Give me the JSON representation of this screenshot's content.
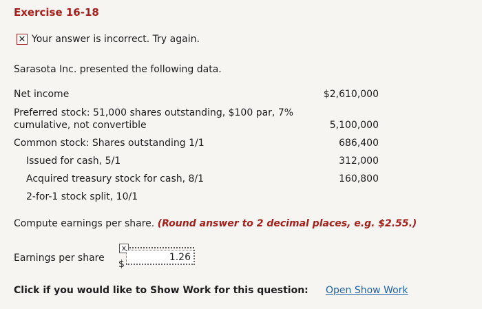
{
  "exercise_title": "Exercise 16-18",
  "status": {
    "icon": "x-icon",
    "message": "Your answer is incorrect.  Try again."
  },
  "intro": "Sarasota Inc. presented the following data.",
  "data_rows": [
    {
      "label": "Net income",
      "value": "$2,610,000"
    },
    {
      "label": "Preferred stock: 51,000 shares outstanding, $100 par, 7%",
      "label2": "cumulative, not convertible",
      "value": "5,100,000"
    },
    {
      "label": "Common stock: Shares outstanding 1/1",
      "value": "686,400"
    },
    {
      "label": "Issued for cash, 5/1",
      "value": "312,000"
    },
    {
      "label": "Acquired treasury stock for cash, 8/1",
      "value": "160,800"
    },
    {
      "label": "2-for-1 stock split, 10/1",
      "value": ""
    }
  ],
  "instruction": {
    "text": "Compute earnings per share. ",
    "hint": "(Round answer to 2 decimal places, e.g. $2.55.)"
  },
  "eps": {
    "label": "Earnings per share",
    "currency": "$",
    "value": "1.26",
    "mark": "x"
  },
  "show_work": {
    "prompt": "Click if you would like to Show Work for this question:",
    "link": "Open Show Work"
  }
}
